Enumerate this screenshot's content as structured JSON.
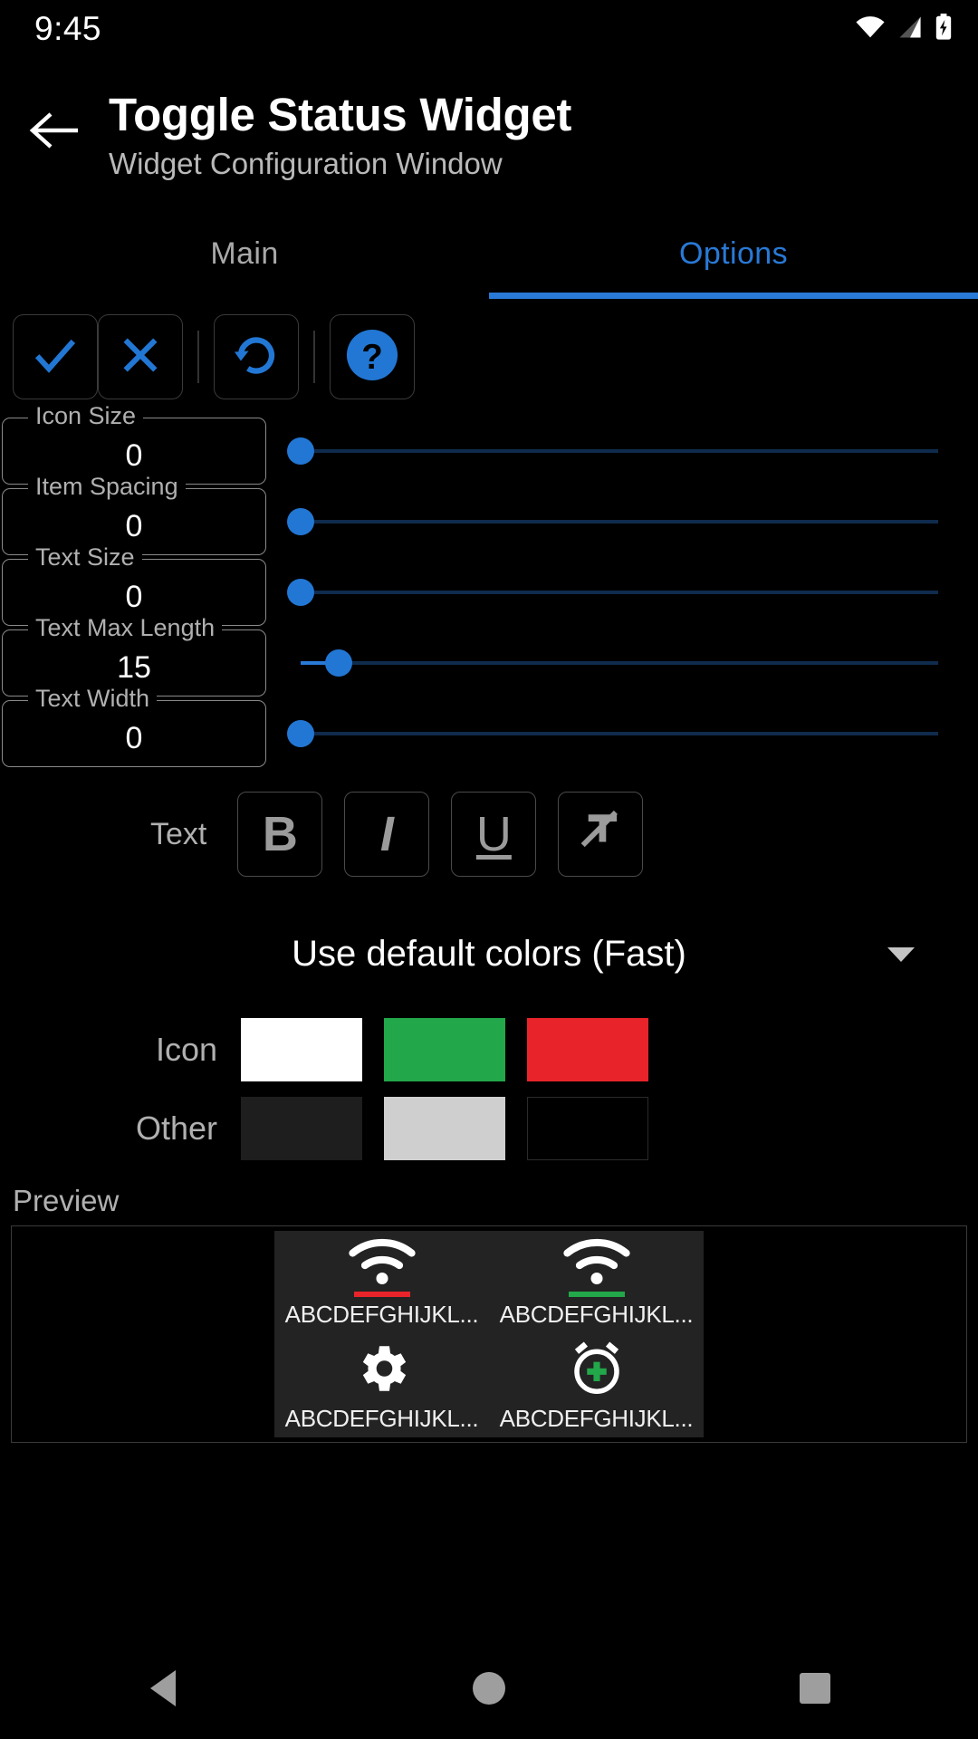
{
  "statusbar": {
    "clock": "9:45",
    "icons": [
      "wifi-icon",
      "cell-signal-icon",
      "battery-charging-icon"
    ]
  },
  "appbar": {
    "back_icon": "arrow-left-icon",
    "title": "Toggle Status Widget",
    "subtitle": "Widget Configuration Window"
  },
  "tabs": [
    {
      "label": "Main",
      "active": false
    },
    {
      "label": "Options",
      "active": true
    }
  ],
  "action_buttons": [
    {
      "name": "confirm-button",
      "icon": "check-icon"
    },
    {
      "name": "cancel-button",
      "icon": "close-icon"
    },
    {
      "name": "reset-button",
      "icon": "restore-rotate-icon"
    },
    {
      "name": "help-button",
      "icon": "question-circle-icon"
    }
  ],
  "settings": [
    {
      "label": "Icon Size",
      "value": "0",
      "slider_percent": 0
    },
    {
      "label": "Item Spacing",
      "value": "0",
      "slider_percent": 0
    },
    {
      "label": "Text Size",
      "value": "0",
      "slider_percent": 0
    },
    {
      "label": "Text Max Length",
      "value": "15",
      "slider_percent": 6
    },
    {
      "label": "Text Width",
      "value": "0",
      "slider_percent": 0
    }
  ],
  "text_style": {
    "label": "Text",
    "buttons": [
      {
        "name": "bold-button",
        "glyph": "B"
      },
      {
        "name": "italic-button",
        "glyph": "I"
      },
      {
        "name": "underline-button",
        "glyph": "U"
      },
      {
        "name": "strikethrough-button",
        "glyph": "T"
      }
    ]
  },
  "color_mode": {
    "selected": "Use default colors (Fast)",
    "caret_icon": "chevron-down-icon"
  },
  "color_rows": [
    {
      "label": "Icon",
      "swatches": [
        "#FFFFFF",
        "#22A74A",
        "#E8242A"
      ]
    },
    {
      "label": "Other",
      "swatches": [
        "#1E1E1E",
        "#CFCFCF",
        "#000000"
      ]
    }
  ],
  "preview": {
    "label": "Preview",
    "background": "#232323",
    "cells": [
      {
        "icon": "wifi-icon",
        "icon_color": "#FFFFFF",
        "bar_color": "#E8242A",
        "text": "ABCDEFGHIJKL..."
      },
      {
        "icon": "wifi-icon",
        "icon_color": "#FFFFFF",
        "bar_color": "#22A74A",
        "text": "ABCDEFGHIJKL..."
      },
      {
        "icon": "gear-icon",
        "icon_color": "#FFFFFF",
        "bar_color": "",
        "text": "ABCDEFGHIJKL..."
      },
      {
        "icon": "alarm-add-icon",
        "icon_color": "#FFFFFF",
        "bar_color": "",
        "text": "ABCDEFGHIJKL..."
      }
    ]
  },
  "navbar": [
    {
      "name": "nav-back-button",
      "icon": "triangle-back-icon"
    },
    {
      "name": "nav-home-button",
      "icon": "circle-home-icon"
    },
    {
      "name": "nav-recents-button",
      "icon": "square-recents-icon"
    }
  ],
  "theme": {
    "accent": "#2979D6",
    "background": "#000000",
    "text": "#FFFFFF"
  }
}
